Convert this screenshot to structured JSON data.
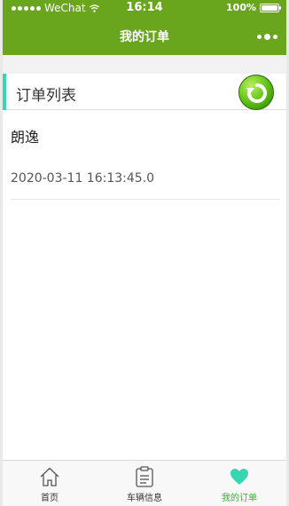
{
  "status_bar": {
    "carrier": "WeChat",
    "time": "16:14",
    "battery": "100%"
  },
  "nav": {
    "title": "我的订单"
  },
  "section": {
    "title": "订单列表"
  },
  "orders": [
    {
      "name": "朗逸",
      "time": "2020-03-11 16:13:45.0"
    }
  ],
  "tabs": [
    {
      "label": "首页",
      "icon": "home-icon"
    },
    {
      "label": "车辆信息",
      "icon": "clipboard-icon"
    },
    {
      "label": "我的订单",
      "icon": "heart-icon"
    }
  ],
  "colors": {
    "nav": "#6aa51e",
    "accent": "#35d6b0",
    "active_tab": "#3cae2f"
  }
}
